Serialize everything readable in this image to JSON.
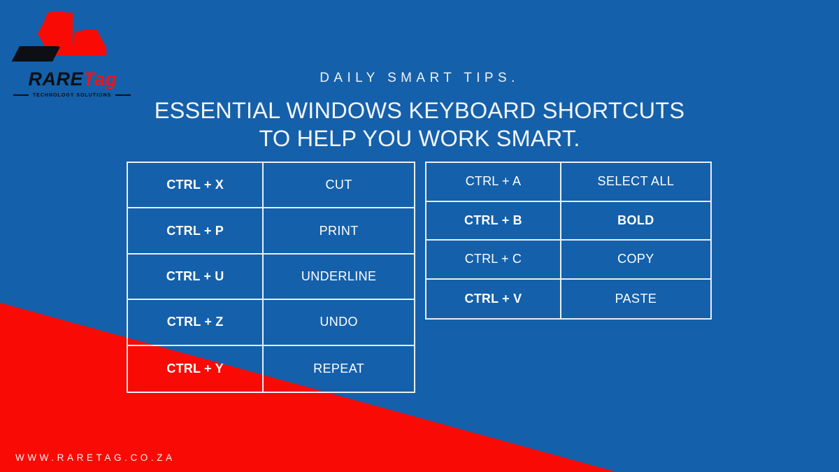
{
  "theme": {
    "background_blue": "#1560aa",
    "accent_red": "#fa0a05",
    "text_white": "#ffffff",
    "border_white": "#e9eef3",
    "logo_black": "#0d0f14",
    "logo_red": "#e8161b"
  },
  "logo": {
    "mark_name": "raretag-chevron-mark",
    "word_primary": "RARE",
    "word_secondary": "Tag",
    "tagline": "TECHNOLOGY SOLUTIONS"
  },
  "header": {
    "eyebrow": "DAILY SMART TIPS.",
    "headline_line1": "ESSENTIAL WINDOWS KEYBOARD SHORTCUTS",
    "headline_line2": "TO HELP YOU WORK SMART."
  },
  "tables": {
    "left": {
      "name": "shortcuts-table-left",
      "rows": [
        {
          "key": "CTRL + X",
          "value": "CUT",
          "key_bold": true,
          "value_bold": false
        },
        {
          "key": "CTRL + P",
          "value": "PRINT",
          "key_bold": true,
          "value_bold": false
        },
        {
          "key": "CTRL + U",
          "value": "UNDERLINE",
          "key_bold": true,
          "value_bold": false
        },
        {
          "key": "CTRL + Z",
          "value": "UNDO",
          "key_bold": true,
          "value_bold": false
        },
        {
          "key": "CTRL + Y",
          "value": "REPEAT",
          "key_bold": true,
          "value_bold": false
        }
      ]
    },
    "right": {
      "name": "shortcuts-table-right",
      "rows": [
        {
          "key": "CTRL + A",
          "value": "SELECT ALL",
          "key_bold": false,
          "value_bold": false
        },
        {
          "key": "CTRL + B",
          "value": "BOLD",
          "key_bold": true,
          "value_bold": true
        },
        {
          "key": "CTRL + C",
          "value": "COPY",
          "key_bold": false,
          "value_bold": false
        },
        {
          "key": "CTRL + V",
          "value": "PASTE",
          "key_bold": true,
          "value_bold": false
        }
      ]
    }
  },
  "footer": {
    "website": "W W W . R A R E T A G . C O . Z A",
    "website_plain": "WWW.RARETAG.CO.ZA"
  }
}
